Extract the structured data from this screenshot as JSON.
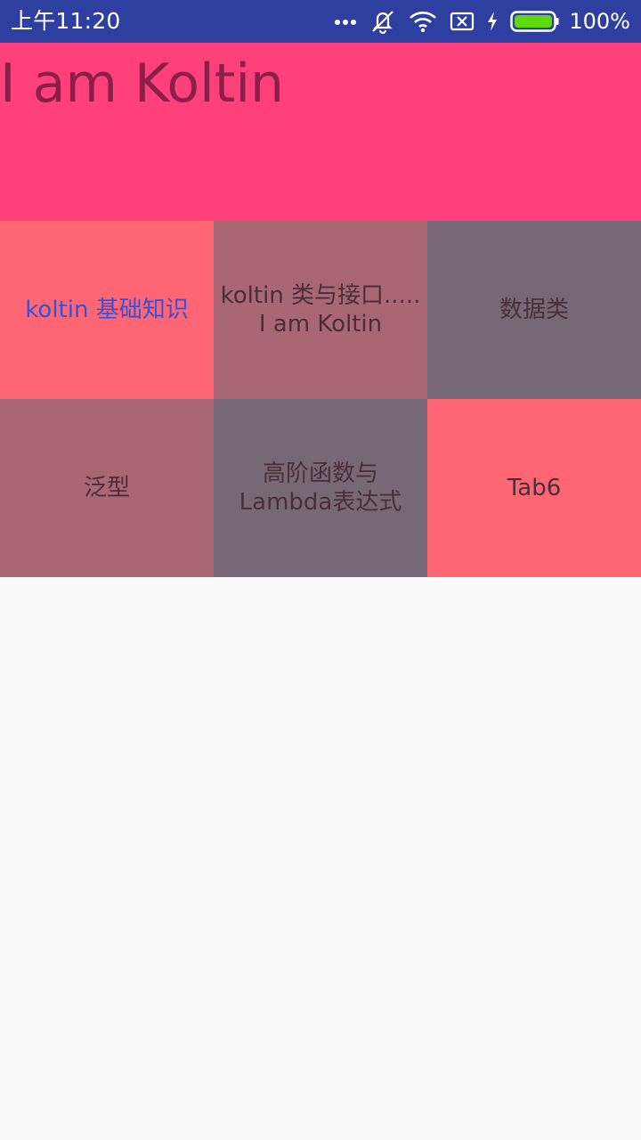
{
  "status_bar": {
    "time": "上午11:20",
    "battery_percent": "100%",
    "battery_level": 1.0,
    "colors": {
      "background": "#2f3f9f",
      "battery_fill": "#5fd80a"
    },
    "icons": [
      "more-dots-icon",
      "mute-vibrate-icon",
      "wifi-icon",
      "sim-error-icon",
      "charging-bolt-icon",
      "battery-icon"
    ]
  },
  "header": {
    "title": "I am Koltin",
    "background": "#ff407a",
    "title_color": "#8a1f4a"
  },
  "tabs": [
    {
      "label": "koltin 基础知识",
      "selected": true
    },
    {
      "label": "koltin 类与接口.....\nI am Koltin",
      "selected": false
    },
    {
      "label": "数据类",
      "selected": false
    },
    {
      "label": "泛型",
      "selected": false
    },
    {
      "label": "高阶函数与\nLambda表达式",
      "selected": false
    },
    {
      "label": "Tab6",
      "selected": false
    }
  ],
  "tab_colors": {
    "red": "#ff6673",
    "rose": "#a86773",
    "slate": "#776877",
    "selected_text": "#3b4fd6"
  }
}
